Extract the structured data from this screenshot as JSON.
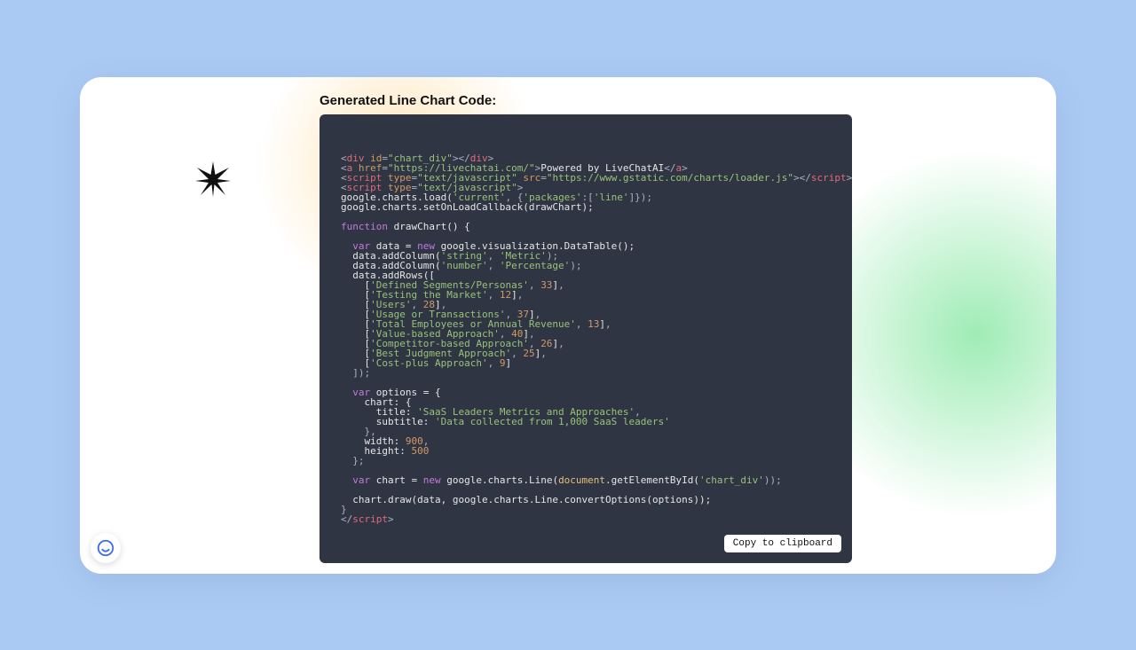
{
  "heading": "Generated Line Chart Code:",
  "copy_label": "Copy to clipboard",
  "code": {
    "div_id": "chart_div",
    "link_href": "https://livechatai.com/",
    "link_text": "Powered by LiveChatAI",
    "script1_type": "text/javascript",
    "script1_src": "https://www.gstatic.com/charts/loader.js",
    "script2_type": "text/javascript",
    "load_arg1": "current",
    "load_packages_key": "packages",
    "load_packages_val": "line",
    "callback_name": "drawChart",
    "col1_type": "string",
    "col1_name": "Metric",
    "col2_type": "number",
    "col2_name": "Percentage",
    "rows": [
      [
        "Defined Segments/Personas",
        33
      ],
      [
        "Testing the Market",
        12
      ],
      [
        "Users",
        28
      ],
      [
        "Usage or Transactions",
        37
      ],
      [
        "Total Employees or Annual Revenue",
        13
      ],
      [
        "Value-based Approach",
        40
      ],
      [
        "Competitor-based Approach",
        26
      ],
      [
        "Best Judgment Approach",
        25
      ],
      [
        "Cost-plus Approach",
        9
      ]
    ],
    "options_title": "SaaS Leaders Metrics and Approaches",
    "options_subtitle": "Data collected from 1,000 SaaS leaders",
    "options_width": 900,
    "options_height": 500,
    "chart_target": "chart_div"
  }
}
